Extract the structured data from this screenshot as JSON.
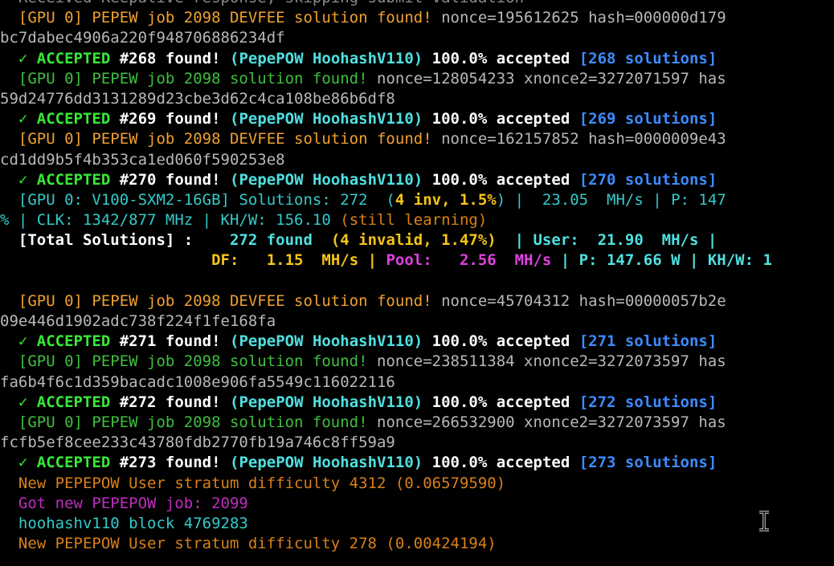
{
  "colors": {
    "gray": "#b8b8b8",
    "dimgray": "#8a8a8a",
    "orange": "#f0a030",
    "gold": "#f5c518",
    "green": "#3fbf3f",
    "brightgreen": "#38e838",
    "cyan": "#36c9c9",
    "brightcyan": "#4fe0e0",
    "blue": "#3d8bff",
    "white": "#ffffff",
    "magenta": "#e040e0",
    "purple": "#c02cc0",
    "darkorange": "#d98018"
  },
  "terminal": {
    "lines": [
      {
        "segs": [
          {
            "t": "  Received Keepative response; skipping submit validation",
            "c": "dimgray"
          }
        ]
      },
      {
        "segs": [
          {
            "t": "  [GPU 0] PEPEW job 2098 DEVFEE solution found! ",
            "c": "orange"
          },
          {
            "t": "nonce=195612625 hash=000000d179",
            "c": "gray"
          }
        ]
      },
      {
        "segs": [
          {
            "t": "bc7dabec4906a220f948706886234df",
            "c": "gray"
          }
        ]
      },
      {
        "segs": [
          {
            "t": "  ✓ ACCEPTED ",
            "c": "brightgreen",
            "b": true
          },
          {
            "t": "#268 found! ",
            "c": "white",
            "b": true
          },
          {
            "t": "(PepePOW HoohashV110) ",
            "c": "brightcyan",
            "b": true
          },
          {
            "t": "100.0% accepted ",
            "c": "white",
            "b": true
          },
          {
            "t": "[268 solutions]",
            "c": "blue",
            "b": true
          }
        ]
      },
      {
        "segs": [
          {
            "t": "  [GPU 0] PEPEW job 2098 solution found! ",
            "c": "green"
          },
          {
            "t": "nonce=128054233 xnonce2=3272071597 has",
            "c": "gray"
          }
        ]
      },
      {
        "segs": [
          {
            "t": "59d24776dd3131289d23cbe3d62c4ca108be86b6df8",
            "c": "gray"
          }
        ]
      },
      {
        "segs": [
          {
            "t": "  ✓ ACCEPTED ",
            "c": "brightgreen",
            "b": true
          },
          {
            "t": "#269 found! ",
            "c": "white",
            "b": true
          },
          {
            "t": "(PepePOW HoohashV110) ",
            "c": "brightcyan",
            "b": true
          },
          {
            "t": "100.0% accepted ",
            "c": "white",
            "b": true
          },
          {
            "t": "[269 solutions]",
            "c": "blue",
            "b": true
          }
        ]
      },
      {
        "segs": [
          {
            "t": "  [GPU 0] PEPEW job 2098 DEVFEE solution found! ",
            "c": "orange"
          },
          {
            "t": "nonce=162157852 hash=0000009e43",
            "c": "gray"
          }
        ]
      },
      {
        "segs": [
          {
            "t": "cd1dd9b5f4b353ca1ed060f590253e8",
            "c": "gray"
          }
        ]
      },
      {
        "segs": [
          {
            "t": "  ✓ ACCEPTED ",
            "c": "brightgreen",
            "b": true
          },
          {
            "t": "#270 found! ",
            "c": "white",
            "b": true
          },
          {
            "t": "(PepePOW HoohashV110) ",
            "c": "brightcyan",
            "b": true
          },
          {
            "t": "100.0% accepted ",
            "c": "white",
            "b": true
          },
          {
            "t": "[270 solutions]",
            "c": "blue",
            "b": true
          }
        ]
      },
      {
        "segs": [
          {
            "t": "  [GPU 0: V100-SXM2-16GB] Solutions: 272  (",
            "c": "cyan"
          },
          {
            "t": "4 inv, 1.5%",
            "c": "gold",
            "b": true
          },
          {
            "t": ") |  23.05  MH/s | P: 147",
            "c": "cyan"
          }
        ]
      },
      {
        "segs": [
          {
            "t": "% | CLK: 1342/877 MHz | KH/W: 156.10 ",
            "c": "cyan"
          },
          {
            "t": "(still learning)",
            "c": "darkorange"
          }
        ]
      },
      {
        "segs": [
          {
            "t": "  [Total Solutions] : ",
            "c": "white",
            "b": true
          },
          {
            "t": "   272 found  ",
            "c": "brightcyan",
            "b": true
          },
          {
            "t": "(4 invalid, 1.47%)",
            "c": "gold",
            "b": true
          },
          {
            "t": "  | User:  21.90  MH/s |",
            "c": "brightcyan",
            "b": true
          }
        ]
      },
      {
        "segs": [
          {
            "t": "                       ",
            "c": "white"
          },
          {
            "t": "DF:   1.15  MH/s | ",
            "c": "gold",
            "b": true
          },
          {
            "t": "Pool:   2.56  MH/s",
            "c": "magenta",
            "b": true
          },
          {
            "t": " | P: 147.66 W | KH/W: 1",
            "c": "brightcyan",
            "b": true
          }
        ]
      },
      {
        "segs": [
          {
            "t": "",
            "c": "gray"
          }
        ]
      },
      {
        "segs": [
          {
            "t": "  [GPU 0] PEPEW job 2098 DEVFEE solution found! ",
            "c": "orange"
          },
          {
            "t": "nonce=45704312 hash=00000057b2e",
            "c": "gray"
          }
        ]
      },
      {
        "segs": [
          {
            "t": "09e446d1902adc738f224f1fe168fa",
            "c": "gray"
          }
        ]
      },
      {
        "segs": [
          {
            "t": "  ✓ ACCEPTED ",
            "c": "brightgreen",
            "b": true
          },
          {
            "t": "#271 found! ",
            "c": "white",
            "b": true
          },
          {
            "t": "(PepePOW HoohashV110) ",
            "c": "brightcyan",
            "b": true
          },
          {
            "t": "100.0% accepted ",
            "c": "white",
            "b": true
          },
          {
            "t": "[271 solutions]",
            "c": "blue",
            "b": true
          }
        ]
      },
      {
        "segs": [
          {
            "t": "  [GPU 0] PEPEW job 2098 solution found! ",
            "c": "green"
          },
          {
            "t": "nonce=238511384 xnonce2=3272073597 has",
            "c": "gray"
          }
        ]
      },
      {
        "segs": [
          {
            "t": "fa6b4f6c1d359bacadc1008e906fa5549c116022116",
            "c": "gray"
          }
        ]
      },
      {
        "segs": [
          {
            "t": "  ✓ ACCEPTED ",
            "c": "brightgreen",
            "b": true
          },
          {
            "t": "#272 found! ",
            "c": "white",
            "b": true
          },
          {
            "t": "(PepePOW HoohashV110) ",
            "c": "brightcyan",
            "b": true
          },
          {
            "t": "100.0% accepted ",
            "c": "white",
            "b": true
          },
          {
            "t": "[272 solutions]",
            "c": "blue",
            "b": true
          }
        ]
      },
      {
        "segs": [
          {
            "t": "  [GPU 0] PEPEW job 2098 solution found! ",
            "c": "green"
          },
          {
            "t": "nonce=266532900 xnonce2=3272073597 has",
            "c": "gray"
          }
        ]
      },
      {
        "segs": [
          {
            "t": "fcfb5ef8cee233c43780fdb2770fb19a746c8ff59a9",
            "c": "gray"
          }
        ]
      },
      {
        "segs": [
          {
            "t": "  ✓ ACCEPTED ",
            "c": "brightgreen",
            "b": true
          },
          {
            "t": "#273 found! ",
            "c": "white",
            "b": true
          },
          {
            "t": "(PepePOW HoohashV110) ",
            "c": "brightcyan",
            "b": true
          },
          {
            "t": "100.0% accepted ",
            "c": "white",
            "b": true
          },
          {
            "t": "[273 solutions]",
            "c": "blue",
            "b": true
          }
        ]
      },
      {
        "segs": [
          {
            "t": "  New PEPEPOW User stratum difficulty 4312 (0.06579590)",
            "c": "darkorange"
          }
        ]
      },
      {
        "segs": [
          {
            "t": "  Got new PEPEPOW job: 2099",
            "c": "purple"
          }
        ]
      },
      {
        "segs": [
          {
            "t": "  hoohashv110 block 4769283",
            "c": "cyan"
          }
        ]
      },
      {
        "segs": [
          {
            "t": "  New PEPEPOW User stratum difficulty 278 (0.00424194)",
            "c": "darkorange"
          }
        ]
      }
    ]
  },
  "cursor_icon": "i-beam-cursor-icon"
}
